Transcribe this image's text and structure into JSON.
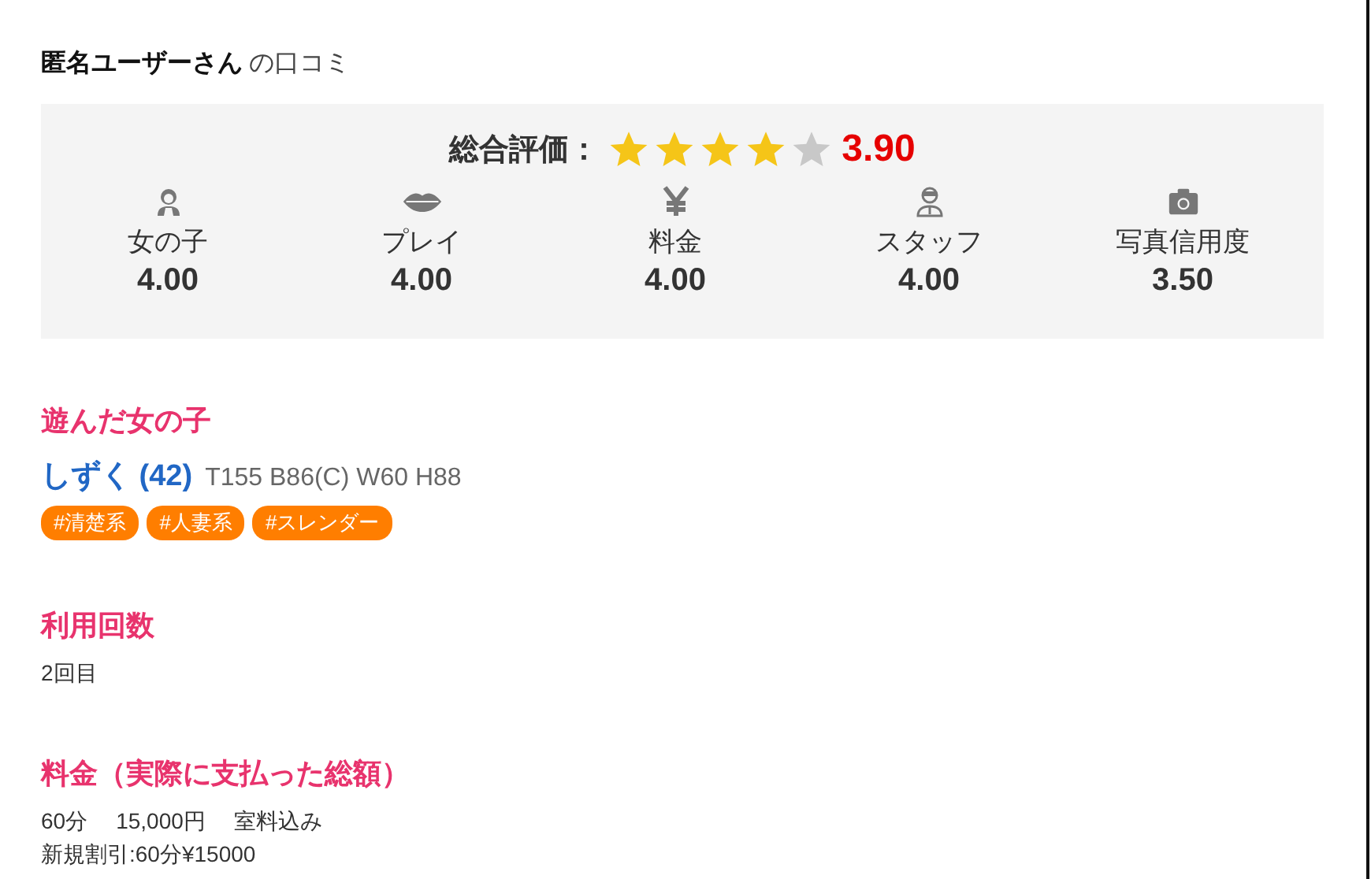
{
  "header": {
    "user": "匿名ユーザーさん",
    "suffix": "の口コミ"
  },
  "overall": {
    "label": "総合評価：",
    "stars": 4,
    "score": "3.90"
  },
  "categories": [
    {
      "label": "女の子",
      "score": "4.00"
    },
    {
      "label": "プレイ",
      "score": "4.00"
    },
    {
      "label": "料金",
      "score": "4.00"
    },
    {
      "label": "スタッフ",
      "score": "4.00"
    },
    {
      "label": "写真信用度",
      "score": "3.50"
    }
  ],
  "girl_section": {
    "heading": "遊んだ女の子",
    "name": "しずく (42)",
    "measurements": "T155 B86(C) W60 H88",
    "tags": [
      "#清楚系",
      "#人妻系",
      "#スレンダー"
    ]
  },
  "visits_section": {
    "heading": "利用回数",
    "value": "2回目"
  },
  "fee_section": {
    "heading": "料金（実際に支払った総額）",
    "items": [
      "60分",
      "15,000円",
      "室料込み"
    ],
    "note": "新規割引:60分¥15000"
  }
}
